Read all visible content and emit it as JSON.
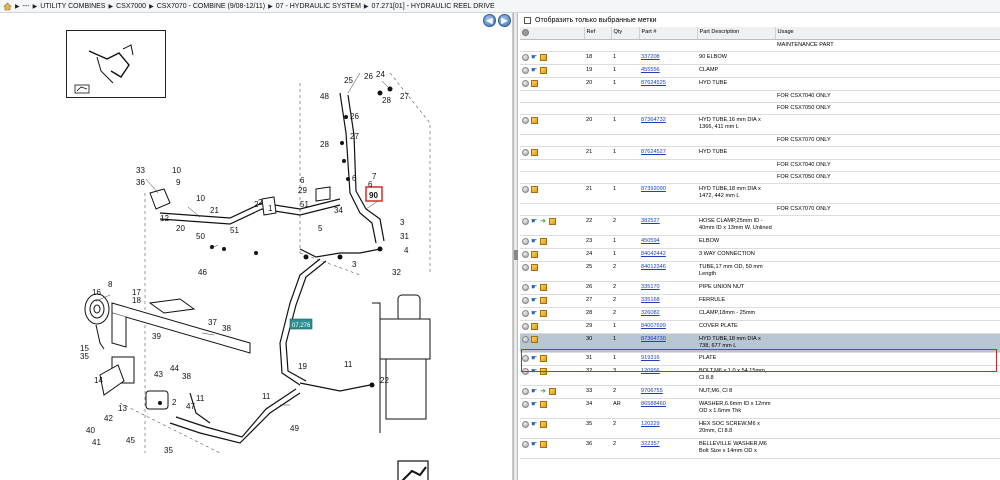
{
  "breadcrumb": {
    "items": [
      "---",
      "UTILITY COMBINES",
      "CSX7000",
      "CSX7070 - COMBINE (9/08-12/11)",
      "07 - HYDRAULIC SYSTEM",
      "07.271[01] - HYDRAULIC REEL DRIVE"
    ]
  },
  "diagram": {
    "callout_selected": "90",
    "callout_ref": "07.276",
    "labels": [
      "33",
      "10",
      "36",
      "9",
      "12",
      "10",
      "20",
      "21",
      "50",
      "51",
      "2",
      "1",
      "46",
      "16",
      "8",
      "17",
      "18",
      "15",
      "35",
      "37",
      "38",
      "39",
      "44",
      "43",
      "38",
      "14",
      "13",
      "42",
      "40",
      "41",
      "45",
      "35",
      "2",
      "11",
      "47",
      "11",
      "49",
      "19",
      "11",
      "22",
      "48",
      "25",
      "26",
      "24",
      "28",
      "27",
      "26",
      "27",
      "28",
      "6",
      "29",
      "2",
      "51",
      "6",
      "34",
      "5",
      "7",
      "6",
      "3",
      "3",
      "32",
      "31",
      "4"
    ]
  },
  "filter": {
    "label": "Отобразить только выбранные метки"
  },
  "table": {
    "headers": {
      "ref": "Ref",
      "qty": "Qty",
      "part": "Part #",
      "desc": "Part Description",
      "usage": "Usage"
    },
    "rows": [
      {
        "type": "sub",
        "usage": "MAINTENANCE PART"
      },
      {
        "type": "row",
        "icons": [
          "info",
          "hand",
          "box"
        ],
        "ref": "18",
        "qty": "1",
        "part": "337208",
        "desc": "90 ELBOW",
        "usage": ""
      },
      {
        "type": "row",
        "icons": [
          "info",
          "hand",
          "box"
        ],
        "ref": "19",
        "qty": "1",
        "part": "455556",
        "desc": "CLAMP",
        "usage": ""
      },
      {
        "type": "row",
        "icons": [
          "info",
          "box"
        ],
        "ref": "20",
        "qty": "1",
        "part": "87624525",
        "desc": "HYD TUBE",
        "usage": ""
      },
      {
        "type": "sub",
        "usage": "FOR CSX7040 ONLY"
      },
      {
        "type": "sub",
        "usage": "FOR CSX7050 ONLY"
      },
      {
        "type": "tall",
        "icons": [
          "info",
          "box"
        ],
        "ref": "20",
        "qty": "1",
        "part": "87364732",
        "desc": "HYD TUBE,16 mm DIA x 1366, 411 mm L",
        "usage": ""
      },
      {
        "type": "sub",
        "usage": "FOR CSX7070 ONLY"
      },
      {
        "type": "row",
        "icons": [
          "info",
          "box"
        ],
        "ref": "21",
        "qty": "1",
        "part": "87624527",
        "desc": "HYD TUBE",
        "usage": ""
      },
      {
        "type": "sub",
        "usage": "FOR CSX7040 ONLY"
      },
      {
        "type": "sub",
        "usage": "FOR CSX7050 ONLY"
      },
      {
        "type": "tall",
        "icons": [
          "info",
          "box"
        ],
        "ref": "21",
        "qty": "1",
        "part": "87392090",
        "desc": "HYD TUBE,18 mm DIA x 1472, 442 mm L",
        "usage": ""
      },
      {
        "type": "sub",
        "usage": "FOR CSX7070 ONLY"
      },
      {
        "type": "tall",
        "icons": [
          "info",
          "hand",
          "leaf",
          "box"
        ],
        "ref": "22",
        "qty": "2",
        "part": "382527",
        "desc": "HOSE CLAMP,25mm ID - 40mm ID x 13mm W, Unlined",
        "usage": ""
      },
      {
        "type": "row",
        "icons": [
          "info",
          "hand",
          "box"
        ],
        "ref": "23",
        "qty": "1",
        "part": "450594",
        "desc": "ELBOW",
        "usage": ""
      },
      {
        "type": "row",
        "icons": [
          "info",
          "box"
        ],
        "ref": "24",
        "qty": "1",
        "part": "84042442",
        "desc": "3 WAY CONNECTION",
        "usage": ""
      },
      {
        "type": "tall",
        "icons": [
          "info",
          "box"
        ],
        "ref": "25",
        "qty": "2",
        "part": "84012346",
        "desc": "TUBE,17 mm OD, 50 mm Length",
        "usage": ""
      },
      {
        "type": "row",
        "icons": [
          "info",
          "hand",
          "box"
        ],
        "ref": "26",
        "qty": "2",
        "part": "335170",
        "desc": "PIPE UNION NUT",
        "usage": ""
      },
      {
        "type": "row",
        "icons": [
          "info",
          "hand",
          "box"
        ],
        "ref": "27",
        "qty": "2",
        "part": "335168",
        "desc": "FERRULE",
        "usage": ""
      },
      {
        "type": "row",
        "icons": [
          "info",
          "hand",
          "box"
        ],
        "ref": "28",
        "qty": "2",
        "part": "326082",
        "desc": "CLAMP,18mm - 25mm",
        "usage": ""
      },
      {
        "type": "row",
        "icons": [
          "info",
          "box"
        ],
        "ref": "29",
        "qty": "1",
        "part": "84007699",
        "desc": "COVER PLATE",
        "usage": ""
      },
      {
        "type": "sel",
        "icons": [
          "info",
          "box"
        ],
        "ref": "30",
        "qty": "1",
        "part": "87364730",
        "desc": "HYD TUBE,18 mm DIA x 738, 677 mm L",
        "usage": ""
      },
      {
        "type": "row",
        "icons": [
          "info",
          "hand",
          "box"
        ],
        "ref": "31",
        "qty": "1",
        "part": "919316",
        "desc": "PLATE",
        "usage": ""
      },
      {
        "type": "tall",
        "icons": [
          "info",
          "hand",
          "box"
        ],
        "ref": "32",
        "qty": "3",
        "part": "120956",
        "desc": "BOLT,M6 x 1.0 x 54.15mm, Cl 8.8",
        "usage": ""
      },
      {
        "type": "row",
        "icons": [
          "info",
          "hand",
          "leaf",
          "box"
        ],
        "ref": "33",
        "qty": "2",
        "part": "9706755",
        "desc": "NUT,M6, Cl 8",
        "usage": ""
      },
      {
        "type": "tall",
        "icons": [
          "info",
          "hand",
          "box"
        ],
        "ref": "34",
        "qty": "AR",
        "part": "86588460",
        "desc": "WASHER,6.6mm ID x 12mm OD x 1.6mm Thk",
        "usage": ""
      },
      {
        "type": "tall",
        "icons": [
          "info",
          "hand",
          "box"
        ],
        "ref": "35",
        "qty": "2",
        "part": "120229",
        "desc": "HEX SOC SCREW,M6 x 20mm, Cl 8.8",
        "usage": ""
      },
      {
        "type": "tall",
        "icons": [
          "info",
          "hand",
          "box"
        ],
        "ref": "36",
        "qty": "2",
        "part": "322357",
        "desc": "BELLEVILLE WASHER,M6 Bolt Size x 14mm OD x",
        "usage": ""
      }
    ]
  }
}
